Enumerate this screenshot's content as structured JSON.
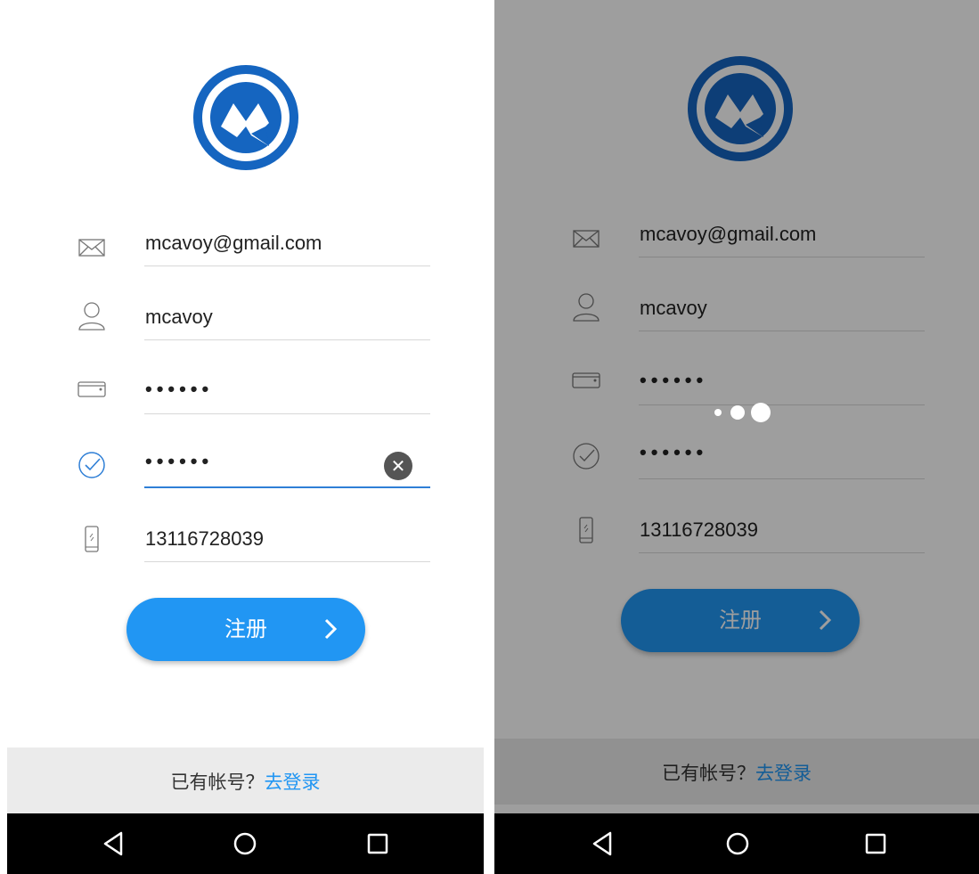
{
  "screens": [
    {
      "state": "editing",
      "fields": [
        {
          "icon": "envelope-icon",
          "value": "mcavoy@gmail.com",
          "type": "text"
        },
        {
          "icon": "user-icon",
          "value": "mcavoy",
          "type": "text"
        },
        {
          "icon": "password-card-icon",
          "value": "••••••",
          "type": "password"
        },
        {
          "icon": "confirm-check-icon",
          "value": "••••••",
          "type": "password",
          "active": true
        },
        {
          "icon": "phone-icon",
          "value": "13116728039",
          "type": "text"
        }
      ],
      "register_label": "注册",
      "footer": {
        "prompt": "已有帐号？",
        "link": "去登录"
      }
    },
    {
      "state": "loading",
      "fields": [
        {
          "icon": "envelope-icon",
          "value": "mcavoy@gmail.com",
          "type": "text"
        },
        {
          "icon": "user-icon",
          "value": "mcavoy",
          "type": "text"
        },
        {
          "icon": "password-card-icon",
          "value": "••••••",
          "type": "password"
        },
        {
          "icon": "confirm-check-icon",
          "value": "••••••",
          "type": "password"
        },
        {
          "icon": "phone-icon",
          "value": "13116728039",
          "type": "text"
        }
      ],
      "register_label": "注册",
      "footer": {
        "prompt": "已有帐号？",
        "link": "去登录"
      }
    }
  ],
  "colors": {
    "accent": "#2196f3",
    "logo_blue": "#1565c0",
    "active_underline": "#2f7fd6",
    "dim_overlay": "rgba(0,0,0,0.38)"
  }
}
